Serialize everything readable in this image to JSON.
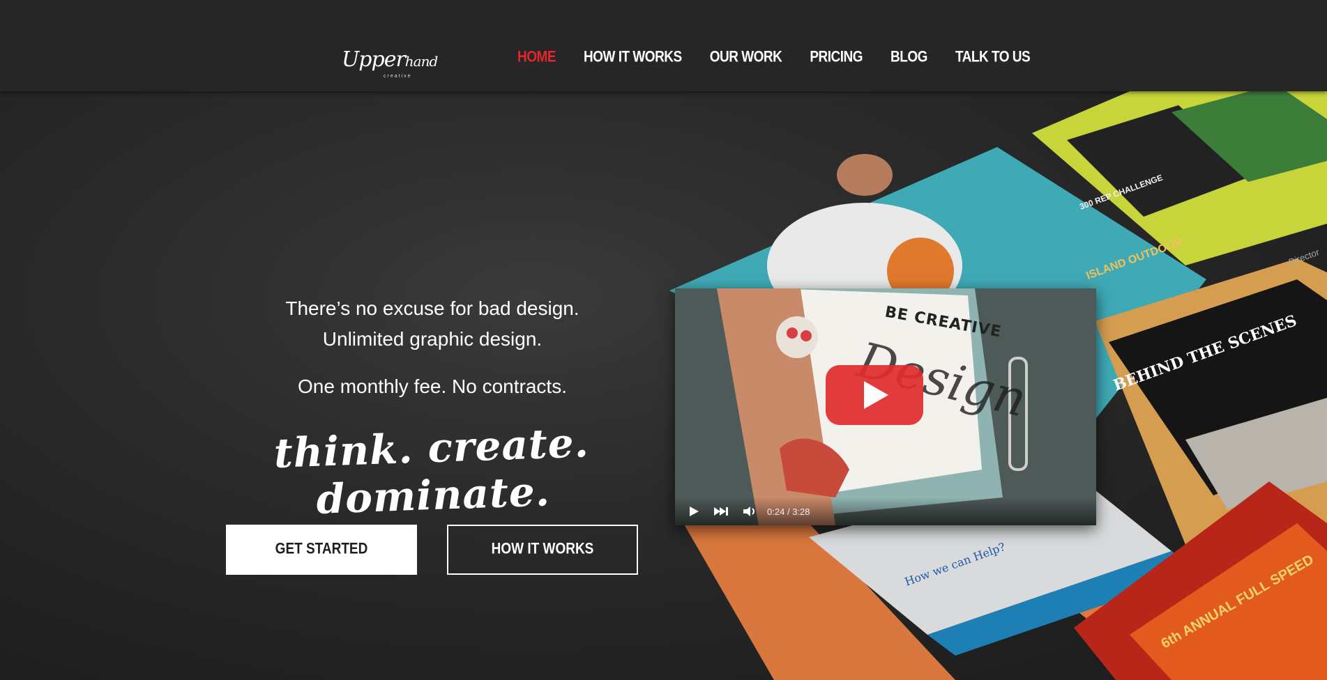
{
  "header": {
    "logo": {
      "word_main": "Upper",
      "word_script": "hand",
      "sub": "creative"
    },
    "nav": [
      {
        "label": "HOME",
        "active": true
      },
      {
        "label": "HOW IT WORKS",
        "active": false
      },
      {
        "label": "OUR WORK",
        "active": false
      },
      {
        "label": "PRICING",
        "active": false
      },
      {
        "label": "BLOG",
        "active": false
      },
      {
        "label": "TALK TO US",
        "active": false
      }
    ]
  },
  "hero": {
    "headline_line1": "There’s no excuse for bad design.",
    "headline_line2": "Unlimited graphic design.",
    "subline": "One monthly fee. No contracts.",
    "tagline": "think. create. dominate.",
    "cta_primary": "GET STARTED",
    "cta_secondary": "HOW IT WORKS"
  },
  "video": {
    "overlay_text": "BE CREATIVE",
    "overlay_word": "Design",
    "current_time": "0:24",
    "separator": "/",
    "duration": "3:28"
  },
  "collage": {
    "items": [
      {
        "text": "ISLAND OUTDOOR"
      },
      {
        "text": "BEHIND THE SCENES"
      },
      {
        "text": "300 REP CHALLENGE"
      },
      {
        "text": "How we can Help?"
      },
      {
        "text": "6th ANNUAL FULL SPEED"
      },
      {
        "text": "Director"
      }
    ]
  },
  "colors": {
    "accent": "#e2262b",
    "header_bg": "#262626",
    "hero_bg": "#1e1e1e",
    "play_red": "#e02c2c"
  }
}
